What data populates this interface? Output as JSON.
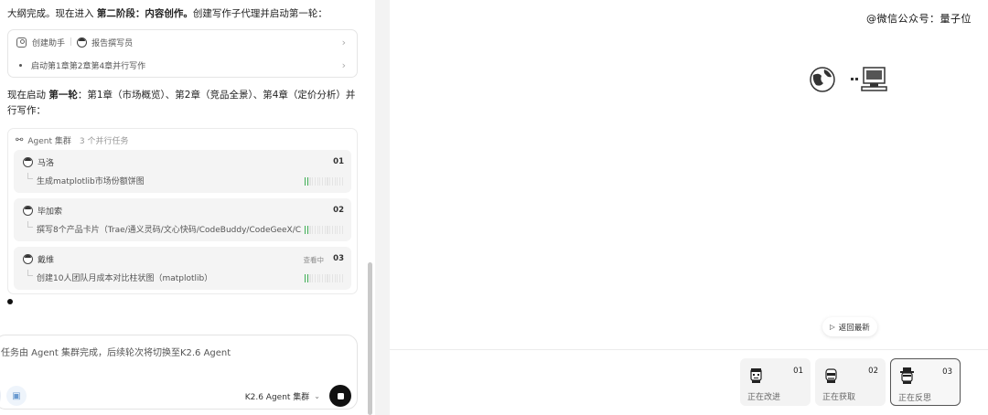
{
  "chat": {
    "intro_prefix": "大纲完成。现在进入 ",
    "intro_bold": "第二阶段：内容创作。",
    "intro_suffix": "创建写作子代理并启动第一轮：",
    "step_card": {
      "create_label": "创建助手",
      "agent_name": "报告撰写员",
      "task_line": "启动第1章第2章第4章并行写作"
    },
    "round_prefix": "现在启动 ",
    "round_bold": "第一轮",
    "round_suffix": "：第1章（市场概览）、第2章（竞品全景）、第4章（定价分析）并行写作：",
    "agent_cluster": {
      "title": "Agent 集群",
      "subtitle": "3 个并行任务",
      "tasks": [
        {
          "name": "马洛",
          "num": "01",
          "status": "",
          "desc": "生成matplotlib市场份额饼图",
          "progress": 0.15
        },
        {
          "name": "毕加索",
          "num": "02",
          "status": "",
          "desc": "撰写8个产品卡片（Trae/通义灵码/文心快码/CodeBuddy/CodeGeeX/C...",
          "progress": 0.15
        },
        {
          "name": "戴维",
          "num": "03",
          "status": "查看中",
          "desc": "创建10人团队月成本对比柱状图（matplotlib）",
          "progress": 0.15
        }
      ]
    }
  },
  "composer": {
    "text": "任务由 Agent 集群完成，后续轮次将切换至K2.6 Agent",
    "model_label": "K2.6 Agent 集群",
    "caret": "⌄"
  },
  "right": {
    "watermark": "@微信公众号：量子位",
    "latest_button": "返回最新",
    "agents": [
      {
        "num": "01",
        "status": "正在改进",
        "active": false,
        "icon": "agent-avatar-icon"
      },
      {
        "num": "02",
        "status": "正在获取",
        "active": false,
        "icon": "agent-avatar-icon"
      },
      {
        "num": "03",
        "status": "正在反思",
        "active": true,
        "icon": "agent-avatar-icon"
      }
    ]
  },
  "colors": {
    "progress_green": "#3fae55",
    "stop_button": "#111111"
  }
}
